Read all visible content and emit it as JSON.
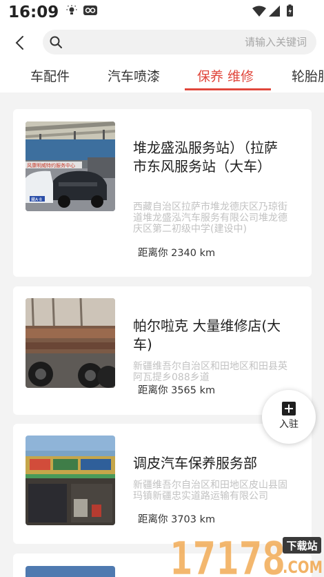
{
  "status_bar": {
    "time": "16:09"
  },
  "search": {
    "placeholder": "请输入关键词",
    "value": ""
  },
  "tabs": [
    {
      "label": "车配件"
    },
    {
      "label": "汽车喷漆"
    },
    {
      "label": "保养 维修",
      "active": true
    },
    {
      "label": "轮胎服"
    }
  ],
  "listings": [
    {
      "title": "堆龙盛泓服务站）（拉萨市东风服务站（大车）",
      "address": "西藏自治区拉萨市堆龙德庆区乃琼街道堆龙盛泓汽车服务有限公司堆龙德庆区第二初级中学(建设中)",
      "distance": "距离你 2340 km",
      "image_sign": "风康明威特约服务中心",
      "image_plate": "藏A·8"
    },
    {
      "title": "帕尔啦克 大量维修店(大车)",
      "address": "新疆维吾尔自治区和田地区和田县英阿瓦提乡088乡道",
      "distance": "距离你 3565 km"
    },
    {
      "title": "调皮汽车保养服务部",
      "address": "新疆维吾尔自治区和田地区皮山县固玛镇新疆忠实道路运输有限公司",
      "distance": "距离你 3703 km"
    }
  ],
  "join_button": {
    "label": "入驻"
  },
  "watermark": {
    "number": "17178",
    "badge": "下载站",
    "domain": ".COM"
  },
  "colors": {
    "accent": "#e0463b",
    "background": "#f3f3f3"
  }
}
